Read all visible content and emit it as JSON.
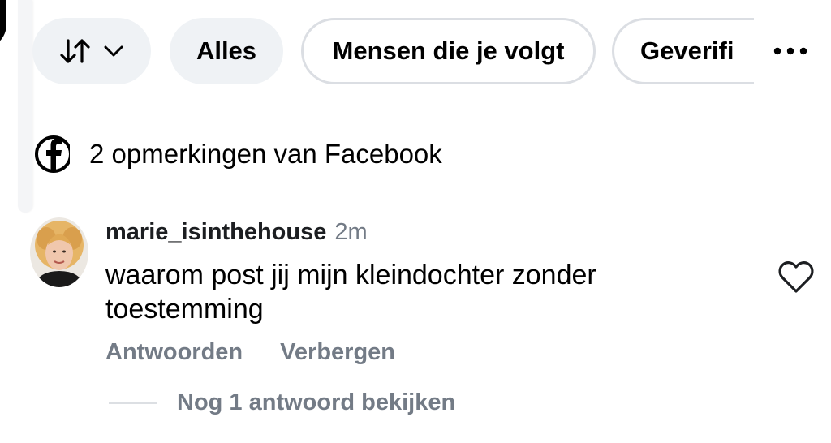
{
  "filters": {
    "sort_label": "",
    "items": [
      {
        "label": "Alles",
        "selected": true
      },
      {
        "label": "Mensen die je volgt",
        "selected": false
      },
      {
        "label": "Geverifi",
        "selected": false
      }
    ],
    "more_icon": "more-horizontal-icon"
  },
  "source": {
    "icon": "facebook-icon",
    "text": "2 opmerkingen van Facebook"
  },
  "comment": {
    "username": "marie_isinthehouse",
    "time": "2m",
    "text": "waarom post jij mijn kleindochter zonder toestemming",
    "reply_label": "Antwoorden",
    "hide_label": "Verbergen",
    "view_replies_label": "Nog 1 antwoord bekijken",
    "like_icon": "heart-icon"
  },
  "colors": {
    "chip_fill": "#eff2f5",
    "chip_border": "#dbdee3",
    "secondary_text": "#737b86"
  }
}
